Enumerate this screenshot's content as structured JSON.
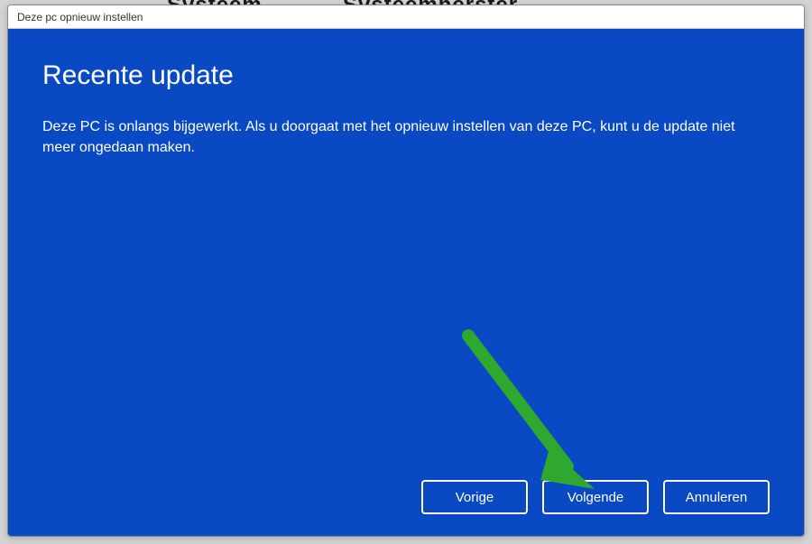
{
  "background": {
    "left_text": "Svsteem",
    "right_text": "Svsteemnerster"
  },
  "window": {
    "title": "Deze pc opnieuw instellen"
  },
  "dialog": {
    "heading": "Recente update",
    "body": "Deze PC is onlangs bijgewerkt. Als u doorgaat met het opnieuw instellen van deze PC, kunt u de update niet meer ongedaan maken."
  },
  "buttons": {
    "previous": "Vorige",
    "next": "Volgende",
    "cancel": "Annuleren"
  },
  "colors": {
    "dialog_bg": "#0a49c4",
    "arrow": "#2fa82f"
  }
}
